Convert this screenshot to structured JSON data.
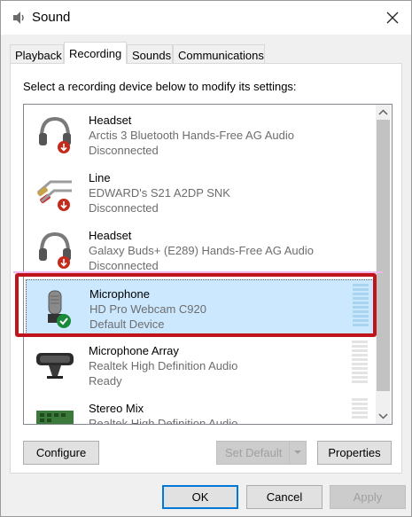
{
  "window": {
    "title": "Sound"
  },
  "tabs": [
    {
      "label": "Playback"
    },
    {
      "label": "Recording"
    },
    {
      "label": "Sounds"
    },
    {
      "label": "Communications"
    }
  ],
  "instruction": "Select a recording device below to modify its settings:",
  "devices": [
    {
      "name": "Headset",
      "description": "Arctis 3 Bluetooth Hands-Free AG Audio",
      "status": "Disconnected",
      "icon": "headset-icon"
    },
    {
      "name": "Line",
      "description": "EDWARD's S21 A2DP SNK",
      "status": "Disconnected",
      "icon": "line-cable-icon"
    },
    {
      "name": "Headset",
      "description": "Galaxy Buds+ (E289) Hands-Free AG Audio",
      "status": "Disconnected",
      "icon": "headset-icon"
    },
    {
      "name": "Microphone",
      "description": "HD Pro Webcam C920",
      "status": "Default Device",
      "icon": "microphone-icon",
      "selected": true
    },
    {
      "name": "Microphone Array",
      "description": "Realtek High Definition Audio",
      "status": "Ready",
      "icon": "microphone-array-icon"
    },
    {
      "name": "Stereo Mix",
      "description": "Realtek High Definition Audio",
      "status": "",
      "icon": "sound-card-icon"
    }
  ],
  "buttons": {
    "configure": "Configure",
    "set_default": "Set Default",
    "properties": "Properties",
    "ok": "OK",
    "cancel": "Cancel",
    "apply": "Apply"
  },
  "colors": {
    "selection": "#cce8ff",
    "highlight_border": "#c0141c",
    "default_check": "#1a8a3a",
    "disconnected_badge": "#c42b1c",
    "accent": "#0078d7"
  }
}
